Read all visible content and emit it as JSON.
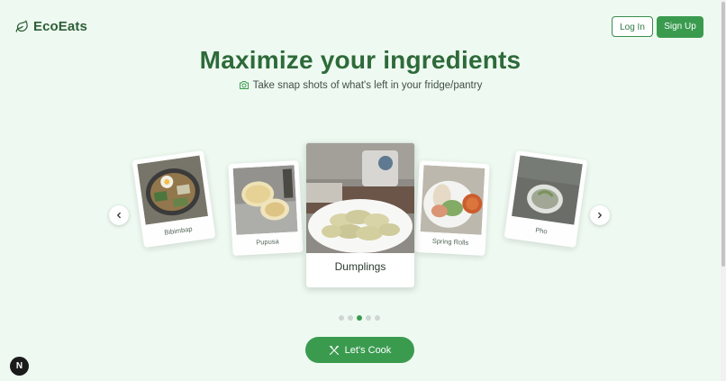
{
  "brand": {
    "name": "EcoEats",
    "icon": "leaf-icon",
    "color": "#2d5e37"
  },
  "header": {
    "login_label": "Log In",
    "signup_label": "Sign Up"
  },
  "hero": {
    "title": "Maximize your ingredients",
    "subtitle": "Take snap shots of what's left in your fridge/pantry",
    "subtitle_icon": "camera-icon"
  },
  "carousel": {
    "items": [
      {
        "label": "Bibimbap"
      },
      {
        "label": "Pupusa"
      },
      {
        "label": "Dumplings"
      },
      {
        "label": "Spring Rolls"
      },
      {
        "label": "Pho"
      }
    ],
    "active_index": 2,
    "prev_icon": "chevron-left-icon",
    "next_icon": "chevron-right-icon"
  },
  "cta": {
    "label": "Let's Cook",
    "icon": "utensils-icon"
  },
  "dev_badge": {
    "letter": "N"
  },
  "colors": {
    "accent": "#3a9b4f",
    "title": "#2e6a3a",
    "background": "#eefaf1"
  }
}
